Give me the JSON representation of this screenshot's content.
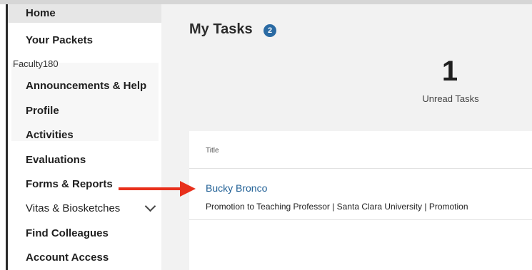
{
  "sidebar": {
    "items_top": [
      {
        "label": "Home"
      },
      {
        "label": "Your Packets"
      }
    ],
    "section_label": "Faculty180",
    "items_section": [
      {
        "label": "Announcements & Help"
      },
      {
        "label": "Profile"
      },
      {
        "label": "Activities"
      },
      {
        "label": "Evaluations"
      },
      {
        "label": "Forms & Reports"
      },
      {
        "label": "Vitas & Biosketches"
      },
      {
        "label": "Find Colleagues"
      },
      {
        "label": "Account Access"
      }
    ]
  },
  "main": {
    "title": "My Tasks",
    "task_count_badge": "2",
    "stat": {
      "value": "1",
      "label": "Unread Tasks"
    },
    "table": {
      "column_header": "Title",
      "rows": [
        {
          "title": "Bucky Bronco",
          "description": "Promotion to Teaching Professor | Santa Clara University | Promotion"
        }
      ]
    }
  },
  "annotation": {
    "arrow_color": "#e8301c"
  },
  "colors": {
    "accent": "#2a6aa3",
    "link": "#1f5f95"
  }
}
